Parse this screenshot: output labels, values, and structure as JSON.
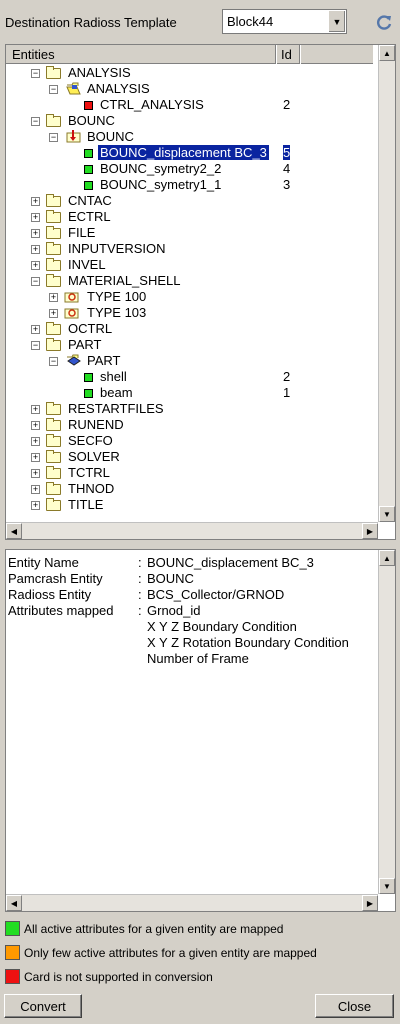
{
  "top": {
    "template_label": "Destination Radioss Template",
    "template_value": "Block44"
  },
  "tree": {
    "columns": {
      "entities": "Entities",
      "id": "Id"
    },
    "rows": [
      {
        "label": "ANALYSIS",
        "id": ""
      },
      {
        "label": "ANALYSIS",
        "id": ""
      },
      {
        "label": "CTRL_ANALYSIS",
        "id": "2"
      },
      {
        "label": "BOUNC",
        "id": ""
      },
      {
        "label": "BOUNC",
        "id": ""
      },
      {
        "label": "BOUNC_displacement BC_3",
        "id": "5"
      },
      {
        "label": "BOUNC_symetry2_2",
        "id": "4"
      },
      {
        "label": "BOUNC_symetry1_1",
        "id": "3"
      },
      {
        "label": "CNTAC",
        "id": ""
      },
      {
        "label": "ECTRL",
        "id": ""
      },
      {
        "label": "FILE",
        "id": ""
      },
      {
        "label": "INPUTVERSION",
        "id": ""
      },
      {
        "label": "INVEL",
        "id": ""
      },
      {
        "label": "MATERIAL_SHELL",
        "id": ""
      },
      {
        "label": "TYPE 100",
        "id": ""
      },
      {
        "label": "TYPE 103",
        "id": ""
      },
      {
        "label": "OCTRL",
        "id": ""
      },
      {
        "label": "PART",
        "id": ""
      },
      {
        "label": "PART",
        "id": ""
      },
      {
        "label": "shell",
        "id": "2"
      },
      {
        "label": "beam",
        "id": "1"
      },
      {
        "label": "RESTARTFILES",
        "id": ""
      },
      {
        "label": "RUNEND",
        "id": ""
      },
      {
        "label": "SECFO",
        "id": ""
      },
      {
        "label": "SOLVER",
        "id": ""
      },
      {
        "label": "TCTRL",
        "id": ""
      },
      {
        "label": "THNOD",
        "id": ""
      },
      {
        "label": "TITLE",
        "id": ""
      }
    ]
  },
  "info": {
    "entity_name_label": "Entity Name",
    "entity_name_value": "BOUNC_displacement BC_3",
    "pamcrash_label": "Pamcrash Entity",
    "pamcrash_value": "BOUNC",
    "radioss_label": "Radioss Entity",
    "radioss_value": "BCS_Collector/GRNOD",
    "attributes_label": "Attributes mapped",
    "sep": ":",
    "attributes": [
      "Grnod_id",
      "X Y Z Boundary Condition",
      "X Y Z Rotation Boundary Condition",
      "Number of Frame"
    ]
  },
  "legend": {
    "green": "All active attributes for a given entity are mapped",
    "orange": "Only few active attributes for a given entity are mapped",
    "red": "Card is not supported in conversion",
    "colors": {
      "green": "#22dd22",
      "orange": "#ff9900",
      "red": "#ee1111"
    }
  },
  "buttons": {
    "convert": "Convert",
    "close": "Close"
  }
}
